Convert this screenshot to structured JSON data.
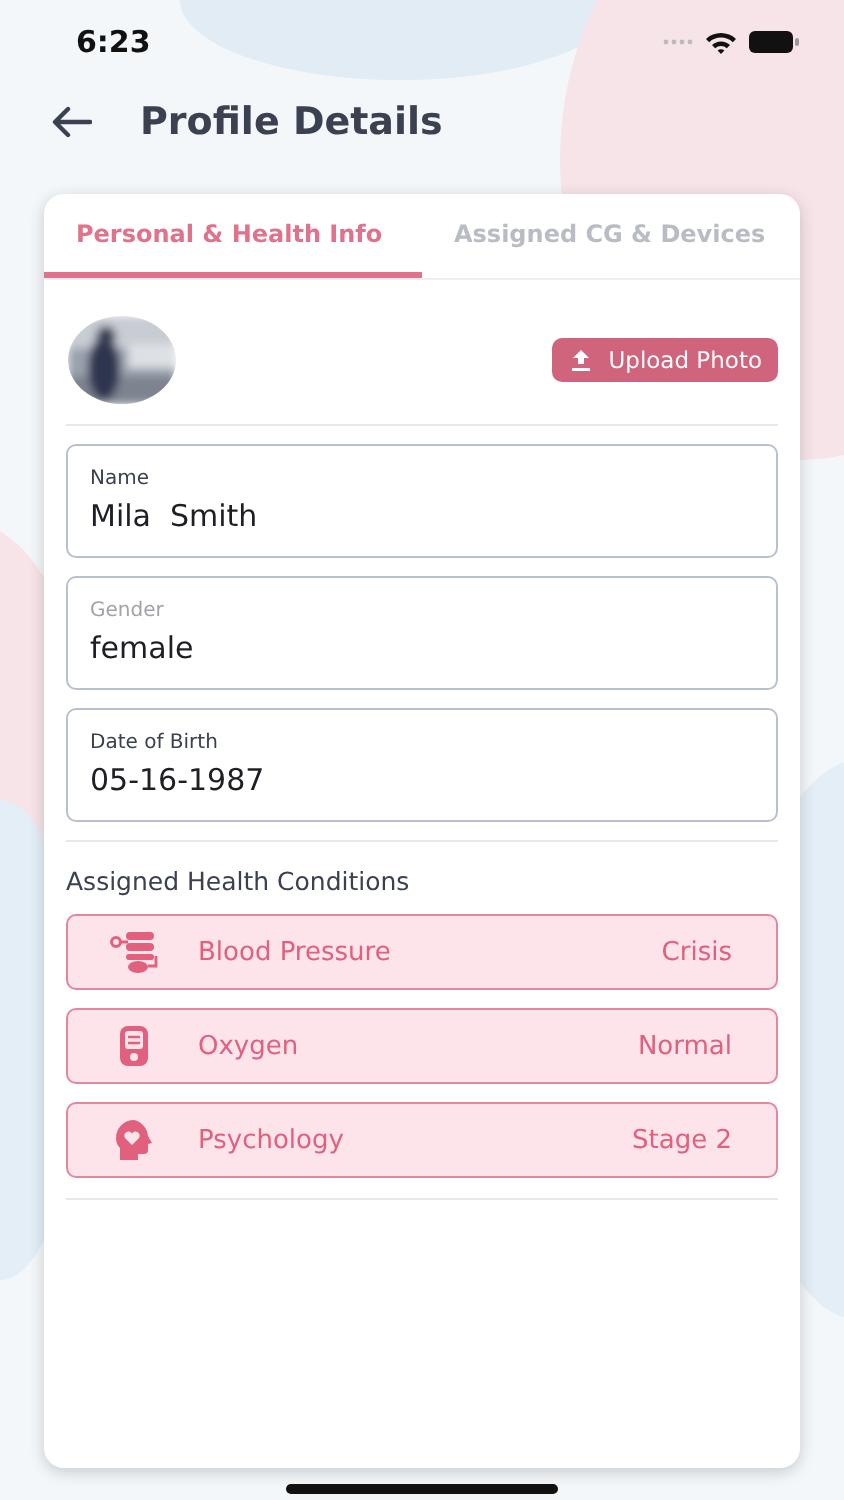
{
  "status_bar": {
    "time": "6:23"
  },
  "header": {
    "title": "Profile Details"
  },
  "tabs": [
    {
      "label": "Personal & Health Info",
      "selected": true
    },
    {
      "label": "Assigned CG & Devices",
      "selected": false
    }
  ],
  "profile": {
    "upload_button": "Upload Photo"
  },
  "fields": [
    {
      "label": "Name",
      "value": "Mila  Smith",
      "muted": false
    },
    {
      "label": "Gender",
      "value": "female",
      "muted": true
    },
    {
      "label": "Date of Birth",
      "value": "05-16-1987",
      "muted": false
    }
  ],
  "conditions_heading": "Assigned Health Conditions",
  "conditions": [
    {
      "kind": "blood_pressure",
      "name": "Blood Pressure",
      "status": "Crisis"
    },
    {
      "kind": "oxygen",
      "name": "Oxygen",
      "status": "Normal"
    },
    {
      "kind": "psychology",
      "name": "Psychology",
      "status": "Stage 2"
    }
  ]
}
